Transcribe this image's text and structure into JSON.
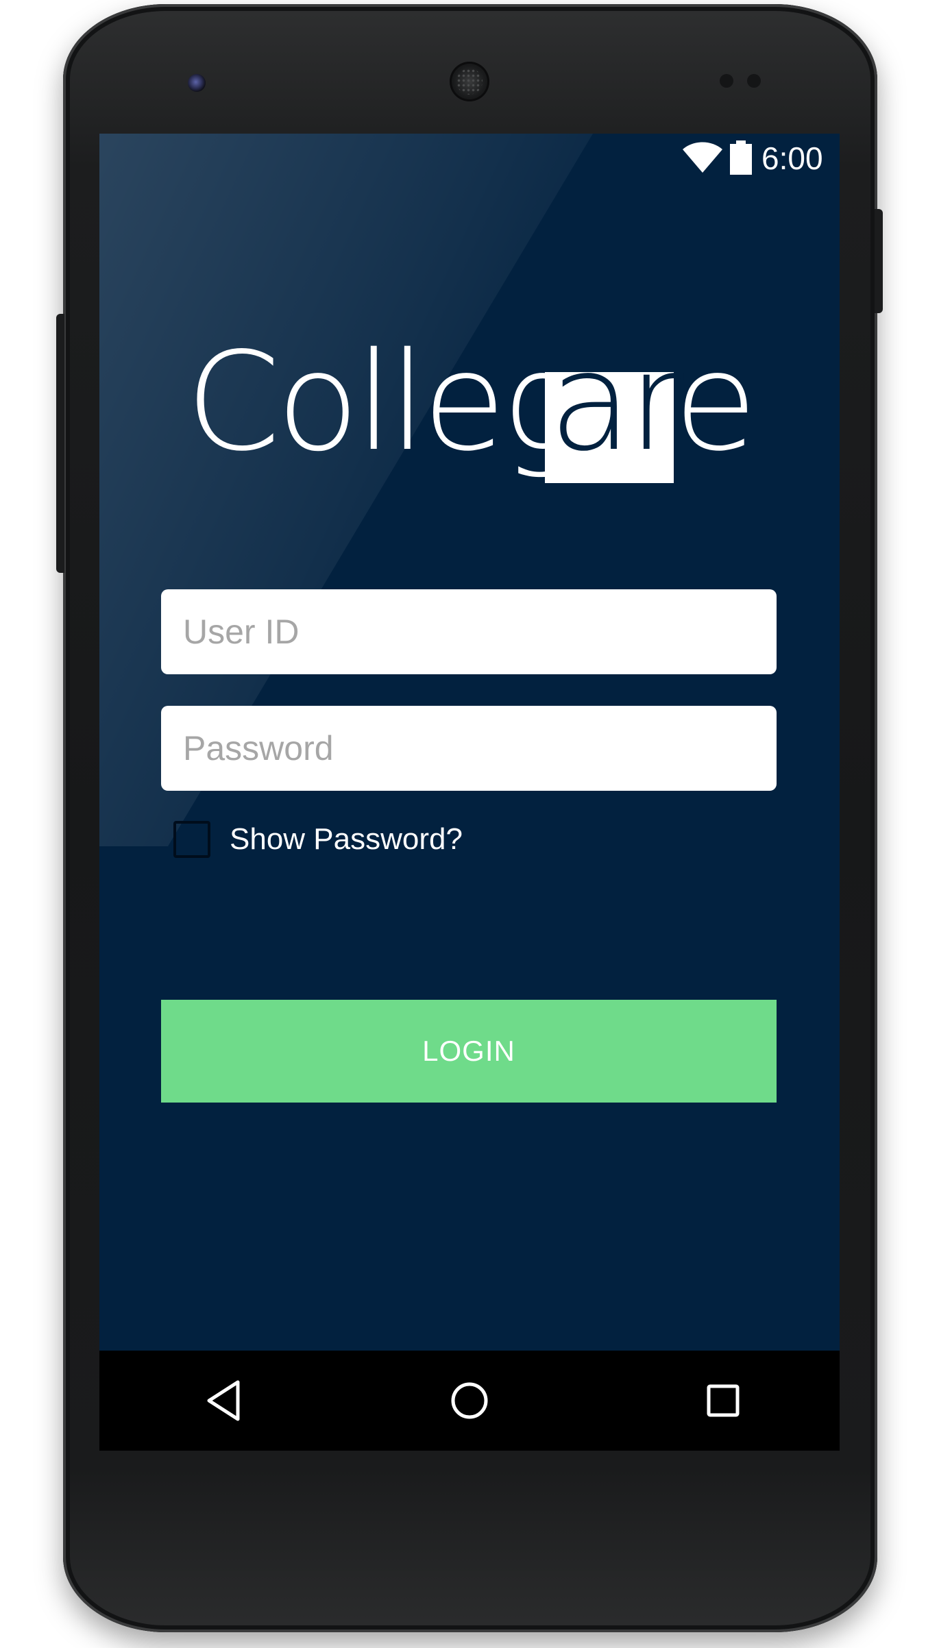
{
  "status_bar": {
    "time": "6:00",
    "icons": [
      "wifi-icon",
      "battery-icon"
    ]
  },
  "logo": {
    "text_before": "Colleg",
    "text_boxed": "ar",
    "text_after": "e"
  },
  "login_form": {
    "user_id": {
      "value": "",
      "placeholder": "User ID"
    },
    "password": {
      "value": "",
      "placeholder": "Password"
    },
    "show_password": {
      "label": "Show Password?",
      "checked": false
    },
    "login_button": "LOGIN"
  },
  "nav_bar": {
    "icons": [
      "back-icon",
      "home-icon",
      "recent-apps-icon"
    ]
  },
  "colors": {
    "background": "#02213f",
    "login_button": "#6fdb8a",
    "field_background": "#ffffff",
    "placeholder": "#a6a6a6"
  }
}
